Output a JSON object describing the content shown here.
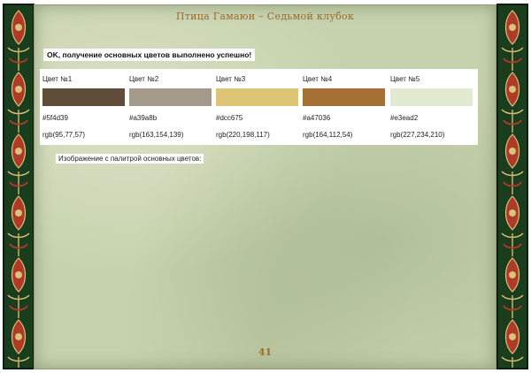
{
  "header": {
    "title": "Птица Гамаюн – Седьмой клубок"
  },
  "status": {
    "message": "OK, получение основных цветов выполнено успешно!"
  },
  "palette": {
    "colors": [
      {
        "label": "Цвет №1",
        "hex": "#5f4d39",
        "rgb": "rgb(95,77,57)"
      },
      {
        "label": "Цвет №2",
        "hex": "#a39a8b",
        "rgb": "rgb(163,154,139)"
      },
      {
        "label": "Цвет №3",
        "hex": "#dcc675",
        "rgb": "rgb(220,198,117)"
      },
      {
        "label": "Цвет №4",
        "hex": "#a47036",
        "rgb": "rgb(164,112,54)"
      },
      {
        "label": "Цвет №5",
        "hex": "#e3ead2",
        "rgb": "rgb(227,234,210)"
      }
    ],
    "image_caption": "Изображение с палитрой основных цветов:"
  },
  "footer": {
    "page_number": "41"
  },
  "theme": {
    "border_green": "#1a3d1e",
    "ornament_red": "#b03a28",
    "ornament_gold": "#d9c27a",
    "parchment": "#c6d2ad",
    "title_color": "#9a6a2a"
  },
  "icons": {
    "border_ornament": "folk-ornament-icon"
  }
}
